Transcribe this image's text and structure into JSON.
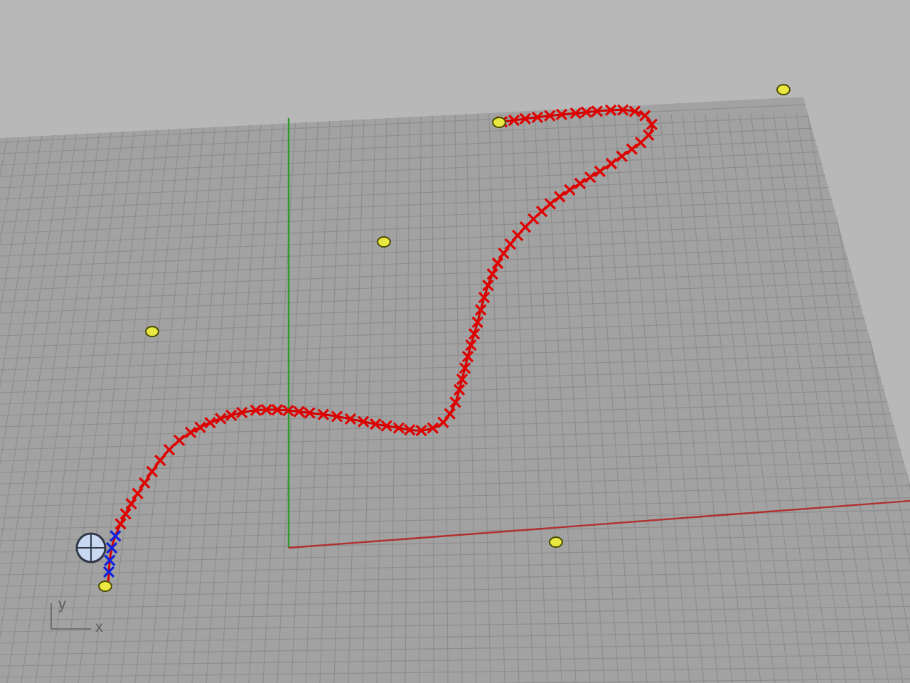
{
  "viewport": {
    "axis_labels": [
      {
        "kind": "y",
        "text": "y"
      },
      {
        "kind": "x",
        "text": "x"
      }
    ]
  }
}
